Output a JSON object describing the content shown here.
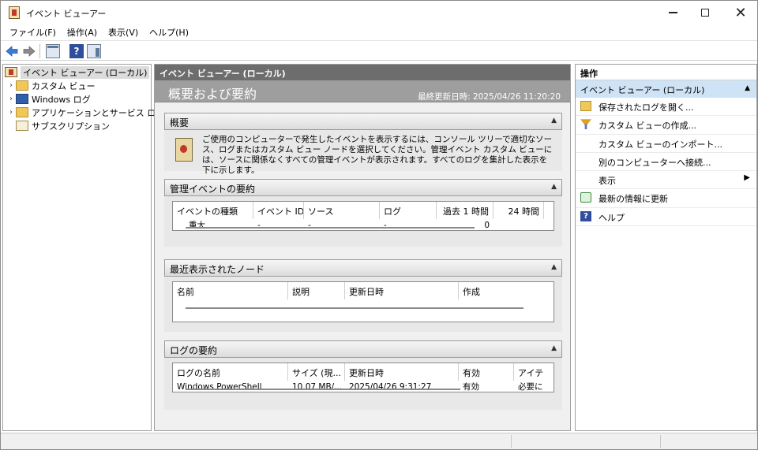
{
  "window": {
    "title": "イベント ビューアー"
  },
  "menu": [
    "ファイル(F)",
    "操作(A)",
    "表示(V)",
    "ヘルプ(H)"
  ],
  "tree": {
    "root": "イベント ビューアー (ローカル)",
    "items": [
      "カスタム ビュー",
      "Windows ログ",
      "アプリケーションとサービス ログ",
      "サブスクリプション"
    ]
  },
  "center": {
    "header": "イベント ビューアー (ローカル)",
    "banner_title": "概要および要約",
    "last_updated": "最終更新日時: 2025/04/26 11:20:20",
    "overview": {
      "title": "概要",
      "text": "ご使用のコンピューターで発生したイベントを表示するには、コンソール ツリーで適切なソース、ログまたはカスタム ビュー ノードを選択してください。管理イベント カスタム ビューには、ソースに関係なくすべての管理イベントが表示されます。すべてのログを集計した表示を下に示します。"
    },
    "admin_summary": {
      "title": "管理イベントの要約",
      "columns": [
        "イベントの種類",
        "イベント ID",
        "ソース",
        "ログ",
        "過去 1 時間",
        "24 時間"
      ],
      "row": [
        "重大",
        "-",
        "-",
        "-",
        "0",
        ""
      ]
    },
    "recent_nodes": {
      "title": "最近表示されたノード",
      "columns": [
        "名前",
        "説明",
        "更新日時",
        "作成"
      ]
    },
    "log_summary": {
      "title": "ログの要約",
      "columns": [
        "ログの名前",
        "サイズ (現...",
        "更新日時",
        "有効",
        "アイテ"
      ],
      "row": [
        "Windows PowerShell",
        "10.07 MB/...",
        "2025/04/26 9:31:27",
        "有効",
        "必要に"
      ]
    }
  },
  "actions": {
    "title": "操作",
    "group": "イベント ビューアー (ローカル)",
    "items": [
      {
        "label": "保存されたログを開く...",
        "icon": "open-folder-icon"
      },
      {
        "label": "カスタム ビューの作成...",
        "icon": "filter-icon"
      },
      {
        "label": "カスタム ビューのインポート...",
        "icon": ""
      },
      {
        "label": "別のコンピューターへ接続...",
        "icon": ""
      },
      {
        "label": "表示",
        "icon": ""
      },
      {
        "label": "最新の情報に更新",
        "icon": "refresh-icon"
      },
      {
        "label": "ヘルプ",
        "icon": "help-icon"
      }
    ]
  }
}
